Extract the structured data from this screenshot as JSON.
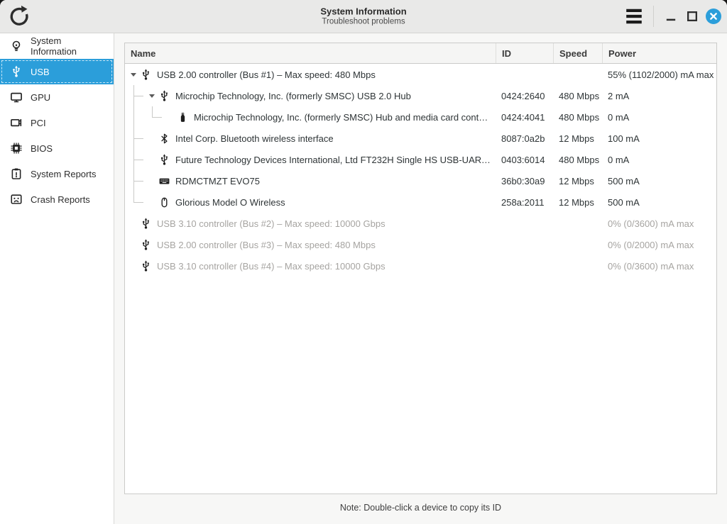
{
  "titlebar": {
    "title": "System Information",
    "subtitle": "Troubleshoot problems",
    "buttons": {
      "refresh": "refresh-icon",
      "menu": "hamburger-menu-icon",
      "minimize": "minimize-icon",
      "maximize": "maximize-icon",
      "close": "close-icon"
    }
  },
  "colors": {
    "accent": "#2b9eda",
    "close_button": "#2b9eda",
    "disabled_text": "#a6a4a1"
  },
  "sidebar": {
    "items": [
      {
        "icon": "lightbulb-icon",
        "label": "System Information",
        "selected": false
      },
      {
        "icon": "usb-icon",
        "label": "USB",
        "selected": true
      },
      {
        "icon": "monitor-icon",
        "label": "GPU",
        "selected": false
      },
      {
        "icon": "pci-card-icon",
        "label": "PCI",
        "selected": false
      },
      {
        "icon": "chip-icon",
        "label": "BIOS",
        "selected": false
      },
      {
        "icon": "clipboard-report-icon",
        "label": "System Reports",
        "selected": false
      },
      {
        "icon": "crash-face-icon",
        "label": "Crash Reports",
        "selected": false
      }
    ]
  },
  "table": {
    "columns": [
      "Name",
      "ID",
      "Speed",
      "Power"
    ],
    "rows": [
      {
        "level": 0,
        "expander": true,
        "icon": "usb-icon",
        "name": "USB 2.00 controller (Bus #1) – Max speed: 480 Mbps",
        "id": "",
        "speed": "",
        "power": "55% (1102/2000) mA max",
        "disabled": false
      },
      {
        "level": 1,
        "expander": true,
        "icon": "usb-icon",
        "name": "Microchip Technology, Inc. (formerly SMSC) USB 2.0 Hub",
        "id": "0424:2640",
        "speed": "480 Mbps",
        "power": "2 mA",
        "disabled": false
      },
      {
        "level": 2,
        "expander": false,
        "icon": "flash-drive-icon",
        "name": "Microchip Technology, Inc. (formerly SMSC) Hub and media card cont…",
        "id": "0424:4041",
        "speed": "480 Mbps",
        "power": "0 mA",
        "disabled": false
      },
      {
        "level": 1,
        "expander": false,
        "icon": "bluetooth-icon",
        "name": "Intel Corp. Bluetooth wireless interface",
        "id": "8087:0a2b",
        "speed": "12 Mbps",
        "power": "100 mA",
        "disabled": false
      },
      {
        "level": 1,
        "expander": false,
        "icon": "usb-icon",
        "name": "Future Technology Devices International, Ltd FT232H Single HS USB-UART…",
        "id": "0403:6014",
        "speed": "480 Mbps",
        "power": "0 mA",
        "disabled": false
      },
      {
        "level": 1,
        "expander": false,
        "icon": "keyboard-icon",
        "name": "RDMCTMZT EVO75",
        "id": "36b0:30a9",
        "speed": "12 Mbps",
        "power": "500 mA",
        "disabled": false
      },
      {
        "level": 1,
        "expander": false,
        "icon": "mouse-icon",
        "name": "Glorious Model O Wireless",
        "id": "258a:2011",
        "speed": "12 Mbps",
        "power": "500 mA",
        "disabled": false
      },
      {
        "level": 0,
        "expander": false,
        "icon": "usb-icon",
        "name": "USB 3.10 controller (Bus #2) – Max speed: 10000 Gbps",
        "id": "",
        "speed": "",
        "power": "0% (0/3600) mA max",
        "disabled": true
      },
      {
        "level": 0,
        "expander": false,
        "icon": "usb-icon",
        "name": "USB 2.00 controller (Bus #3) – Max speed: 480 Mbps",
        "id": "",
        "speed": "",
        "power": "0% (0/2000) mA max",
        "disabled": true
      },
      {
        "level": 0,
        "expander": false,
        "icon": "usb-icon",
        "name": "USB 3.10 controller (Bus #4) – Max speed: 10000 Gbps",
        "id": "",
        "speed": "",
        "power": "0% (0/3600) mA max",
        "disabled": true
      }
    ]
  },
  "footer": {
    "note": "Note: Double-click a device to copy its ID"
  }
}
